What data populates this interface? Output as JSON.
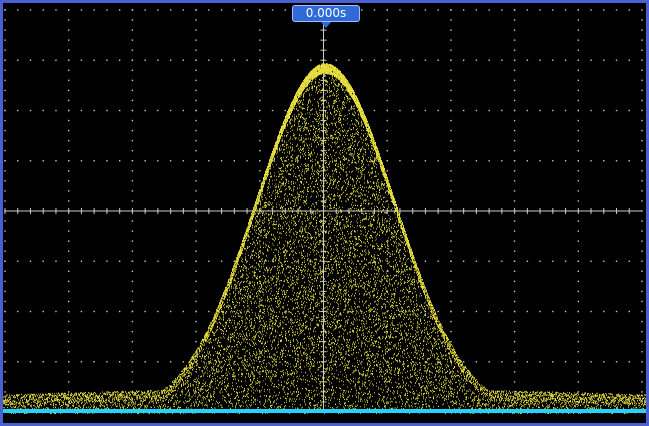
{
  "trigger_time_label": "0.000s",
  "colors": {
    "bezel": "#4a5fd0",
    "screen_background": "#000000",
    "graticule": "#c8c8c8",
    "channel_1_trace": "#e8e040",
    "channel_2_trace": "#22d4ff",
    "trigger_badge": "#2f6ad8"
  },
  "graticule": {
    "horizontal_divisions": 10,
    "vertical_divisions": 8
  },
  "traces": [
    {
      "name_icon": "yellow-trace",
      "shape": "gaussian-envelope"
    },
    {
      "name_icon": "cyan-baseline",
      "shape": "flat"
    }
  ]
}
